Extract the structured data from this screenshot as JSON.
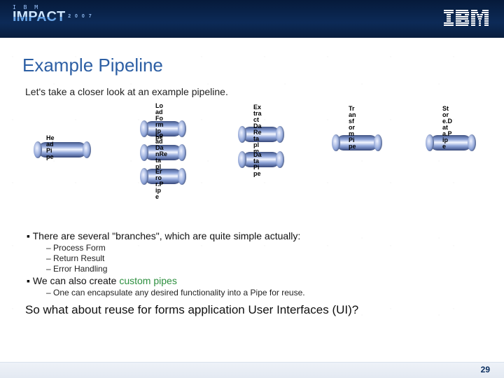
{
  "header": {
    "brand_small": "I B M",
    "brand_big": "IMPACT",
    "year": "2 0 0 7"
  },
  "slide": {
    "title": "Example Pipeline",
    "intro": "Let's take a closer look at an example pipeline.",
    "pipes": {
      "head": "He\nad\nPi\npe",
      "loadForm": "Lo\nad\nFo\nrm\nIp\npe",
      "loadData": "Lo\nad\nDa\nnRe\nta\npl\nm",
      "error": "Er\nro\nr.P\nip\ne",
      "extract": "Ex\ntra\nct\nDa\nRe\nta\npl\nm",
      "extract2": "Da\nta\nPi\npe",
      "transform": "Tr\nan\nsf\nor\nm\nPi\npe",
      "store": "St\nor\ne.D\nat\na.P\nip\ne"
    },
    "bullets": {
      "branches": "There are several \"branches\", which are quite simple actually:",
      "sub1": "Process Form",
      "sub2": "Return Result",
      "sub3": "Error Handling",
      "custom_lead": "We can also create ",
      "custom_em": "custom pipes",
      "custom_sub": "One can encapsulate any desired functionality into a Pipe for reuse."
    },
    "closer": "So what about reuse for forms application User Interfaces (UI)?"
  },
  "footer": {
    "page": "29"
  }
}
